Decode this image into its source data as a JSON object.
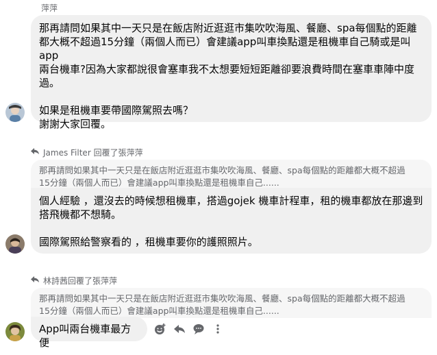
{
  "message1": {
    "sender": "萍萍",
    "text": "那再請問如果其中一天只是在飯店附近逛逛市集吹吹海風、餐廳、spa每個點的距離\n都大概不超過15分鐘（兩個人而已）會建議app叫車換點還是租機車自己騎或是叫app\n兩台機車?因為大家都說很會塞車我不太想要短短距離卻要浪費時間在塞車車陣中度\n過。\n\n如果是租機車要帶國際駕照去嗎？\n謝謝大家回覆。"
  },
  "reply1": {
    "header": "James Filter 回覆了張萍萍",
    "quote": "那再請問如果其中一天只是在飯店附近逛逛市集吹吹海風、餐廳、spa每個點的距離都大概不超過\n15分鐘（兩個人而已）會建議app叫車換點還是租機車自己......",
    "text": "個人經驗 ，還沒去的時候想租機車，搭過gojek 機車計程車，租的機車都放在那邊到\n搭飛機都不想騎。\n\n國際駕照給警察看的 ，租機車要你的護照照片。"
  },
  "reply2": {
    "header": "林詩茜回覆了張萍萍",
    "quote": "那再請問如果其中一天只是在飯店附近逛逛市集吹吹海風、餐廳、spa每個點的距離都大概不超過\n15分鐘（兩個人而已）會建議app叫車換點還是租機車自己......",
    "text": "App叫兩台機車最方便"
  },
  "icons": {
    "reply": "reply-arrow-icon",
    "react": "smiley-plus-icon",
    "forward": "reply-icon",
    "chat": "chat-bubble-icon",
    "more": "more-vertical-icon"
  }
}
